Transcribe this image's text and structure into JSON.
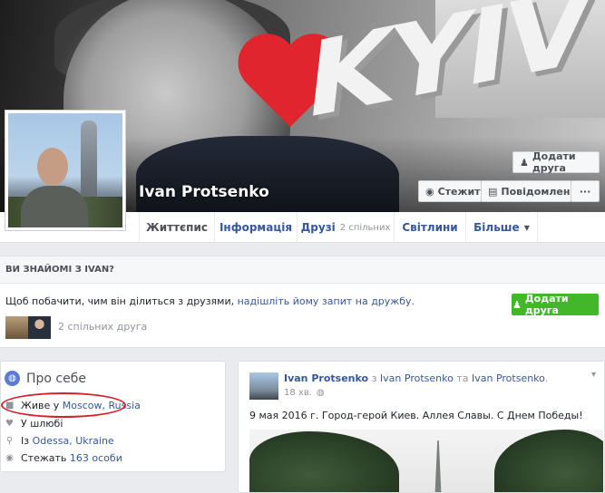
{
  "profile": {
    "name": "Ivan Protsenko"
  },
  "cover": {
    "sign_text": "KYIV",
    "accent": "#e0252f"
  },
  "header_buttons": {
    "add_friend": "Додати друга",
    "follow": "Стежити",
    "message": "Повідомлення",
    "more": "···"
  },
  "nav": {
    "tabs": [
      {
        "label": "Життєпис",
        "sub": "",
        "active": true
      },
      {
        "label": "Інформація",
        "sub": ""
      },
      {
        "label": "Друзі",
        "sub": "2 спільних"
      },
      {
        "label": "Світлини",
        "sub": ""
      },
      {
        "label": "Більше",
        "sub": "",
        "caret": "▼"
      }
    ]
  },
  "know": {
    "heading": "ВИ ЗНАЙОМІ З IVAN?",
    "text_before": "Щоб побачити, чим він ділиться з друзями, ",
    "text_link": "надішліть йому запит на дружбу.",
    "add_friend": "Додати друга",
    "mutual": "2 спільних друга"
  },
  "about": {
    "title": "Про себе",
    "rows": [
      {
        "icon": "home-icon",
        "prefix": "Живе у ",
        "link": "Moscow, Russia"
      },
      {
        "icon": "heart-icon",
        "prefix": "У шлюбі",
        "link": ""
      },
      {
        "icon": "location-icon",
        "prefix": "Із ",
        "link": "Odessa, Ukraine"
      },
      {
        "icon": "follow-icon",
        "prefix": "Стежать ",
        "link": "163 особи"
      }
    ]
  },
  "post": {
    "author": "Ivan Protsenko",
    "with_word": " з ",
    "tagged1": "Ivan Protsenko",
    "and_word": " та ",
    "tagged2": "Ivan Protsenko",
    "dot": ".",
    "time": "18 хв.",
    "privacy_icon": "globe-icon",
    "text": "9 мая 2016 г. Город-герой Киев. Аллея Славы. С Днем Победы!"
  },
  "colors": {
    "link": "#365899",
    "green_button": "#42b72a",
    "annotation_circle": "#d4202a"
  }
}
